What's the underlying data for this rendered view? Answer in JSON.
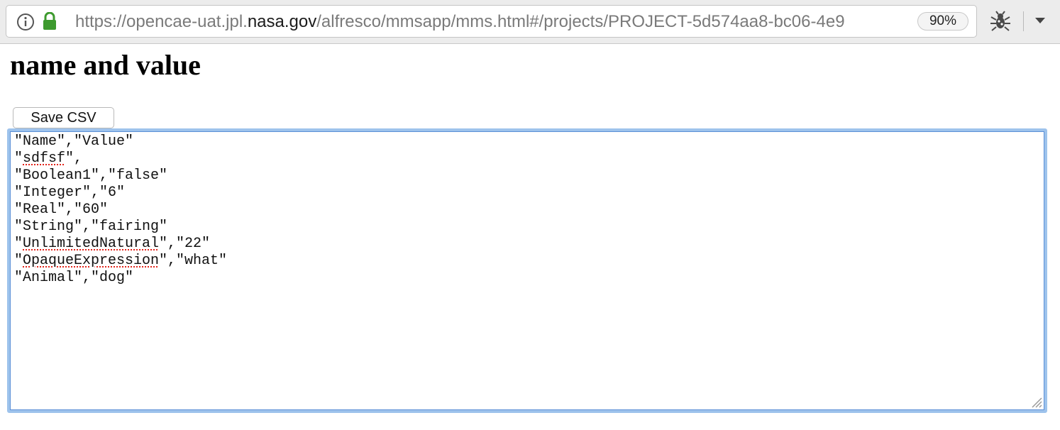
{
  "browser": {
    "url_prefix": "https://opencae-uat.jpl.",
    "url_host": "nasa.gov",
    "url_path": "/alfresco/mmsapp/mms.html#/projects/PROJECT-5d574aa8-bc06-4e9",
    "zoom": "90%"
  },
  "page": {
    "title": "name and value",
    "save_button_label": "Save CSV"
  },
  "csv": {
    "lines": [
      {
        "parts": [
          {
            "text": "\"Name\",\"Value\"",
            "spell": false
          }
        ]
      },
      {
        "parts": [
          {
            "text": "\"",
            "spell": false
          },
          {
            "text": "sdfsf",
            "spell": true
          },
          {
            "text": "\",",
            "spell": false
          }
        ]
      },
      {
        "parts": [
          {
            "text": "\"Boolean1\",\"false\"",
            "spell": false
          }
        ]
      },
      {
        "parts": [
          {
            "text": "\"Integer\",\"6\"",
            "spell": false
          }
        ]
      },
      {
        "parts": [
          {
            "text": "\"Real\",\"60\"",
            "spell": false
          }
        ]
      },
      {
        "parts": [
          {
            "text": "\"String\",\"fairing\"",
            "spell": false
          }
        ]
      },
      {
        "parts": [
          {
            "text": "\"",
            "spell": false
          },
          {
            "text": "UnlimitedNatural",
            "spell": true
          },
          {
            "text": "\",\"22\"",
            "spell": false
          }
        ]
      },
      {
        "parts": [
          {
            "text": "\"",
            "spell": false
          },
          {
            "text": "OpaqueExpression",
            "spell": true
          },
          {
            "text": "\",\"what\"",
            "spell": false
          }
        ]
      },
      {
        "parts": [
          {
            "text": "\"Animal\",\"dog\"",
            "spell": false
          }
        ]
      }
    ]
  },
  "icons": {
    "info": "info-icon",
    "lock": "lock-icon",
    "extension": "bug-extension-icon",
    "menu": "chevron-down-icon",
    "resize": "resize-handle-icon"
  },
  "colors": {
    "lock_green": "#3d9a2e",
    "focus_ring": "#9ec3ec",
    "spellcheck": "#e2231a"
  }
}
